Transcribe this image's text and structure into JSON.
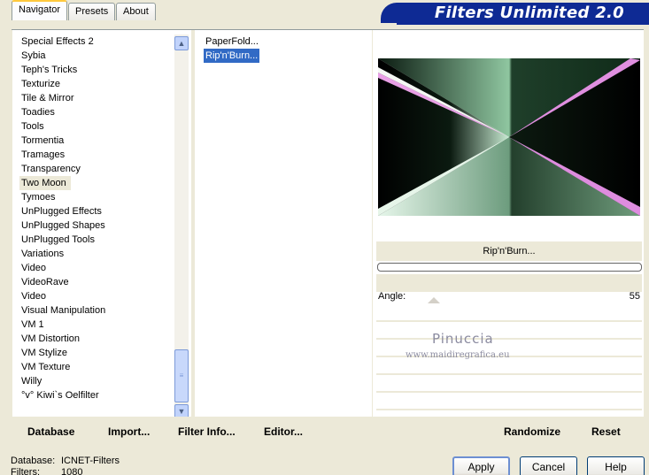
{
  "banner": {
    "title": "Filters Unlimited 2.0"
  },
  "tabs": [
    "Navigator",
    "Presets",
    "About"
  ],
  "categories": [
    "Special Effects 2",
    "Sybia",
    "Teph's Tricks",
    "Texturize",
    "Tile & Mirror",
    "Toadies",
    "Tools",
    "Tormentia",
    "Tramages",
    "Transparency",
    "Two Moon",
    "Tymoes",
    "UnPlugged Effects",
    "UnPlugged Shapes",
    "UnPlugged Tools",
    "Variations",
    "Video",
    "VideoRave",
    "Video",
    "Visual Manipulation",
    "VM 1",
    "VM Distortion",
    "VM Stylize",
    "VM Texture",
    "Willy",
    "°v° Kiwi`s Oelfilter"
  ],
  "selected_category": "Two Moon",
  "filters": [
    "PaperFold...",
    "Rip'n'Burn..."
  ],
  "selected_filter": "Rip'n'Burn...",
  "left_buttons": [
    "Database",
    "Import...",
    "Filter Info...",
    "Editor..."
  ],
  "right_buttons": [
    "Randomize",
    "Reset"
  ],
  "preview": {
    "filter_name": "Rip'n'Burn...",
    "progress": 0
  },
  "params": [
    {
      "label": "Angle:",
      "value": "55"
    }
  ],
  "watermark": {
    "name": "Pinuccia",
    "url": "www.maidiregrafica.eu"
  },
  "status": {
    "database_label": "Database:",
    "database_value": "ICNET-Filters",
    "filters_label": "Filters:",
    "filters_value": "1080"
  },
  "footer_buttons": [
    "Apply",
    "Cancel",
    "Help"
  ],
  "colors": {
    "banner": "#0e2a94",
    "selection": "#316ac5",
    "window": "#ece9d8"
  }
}
